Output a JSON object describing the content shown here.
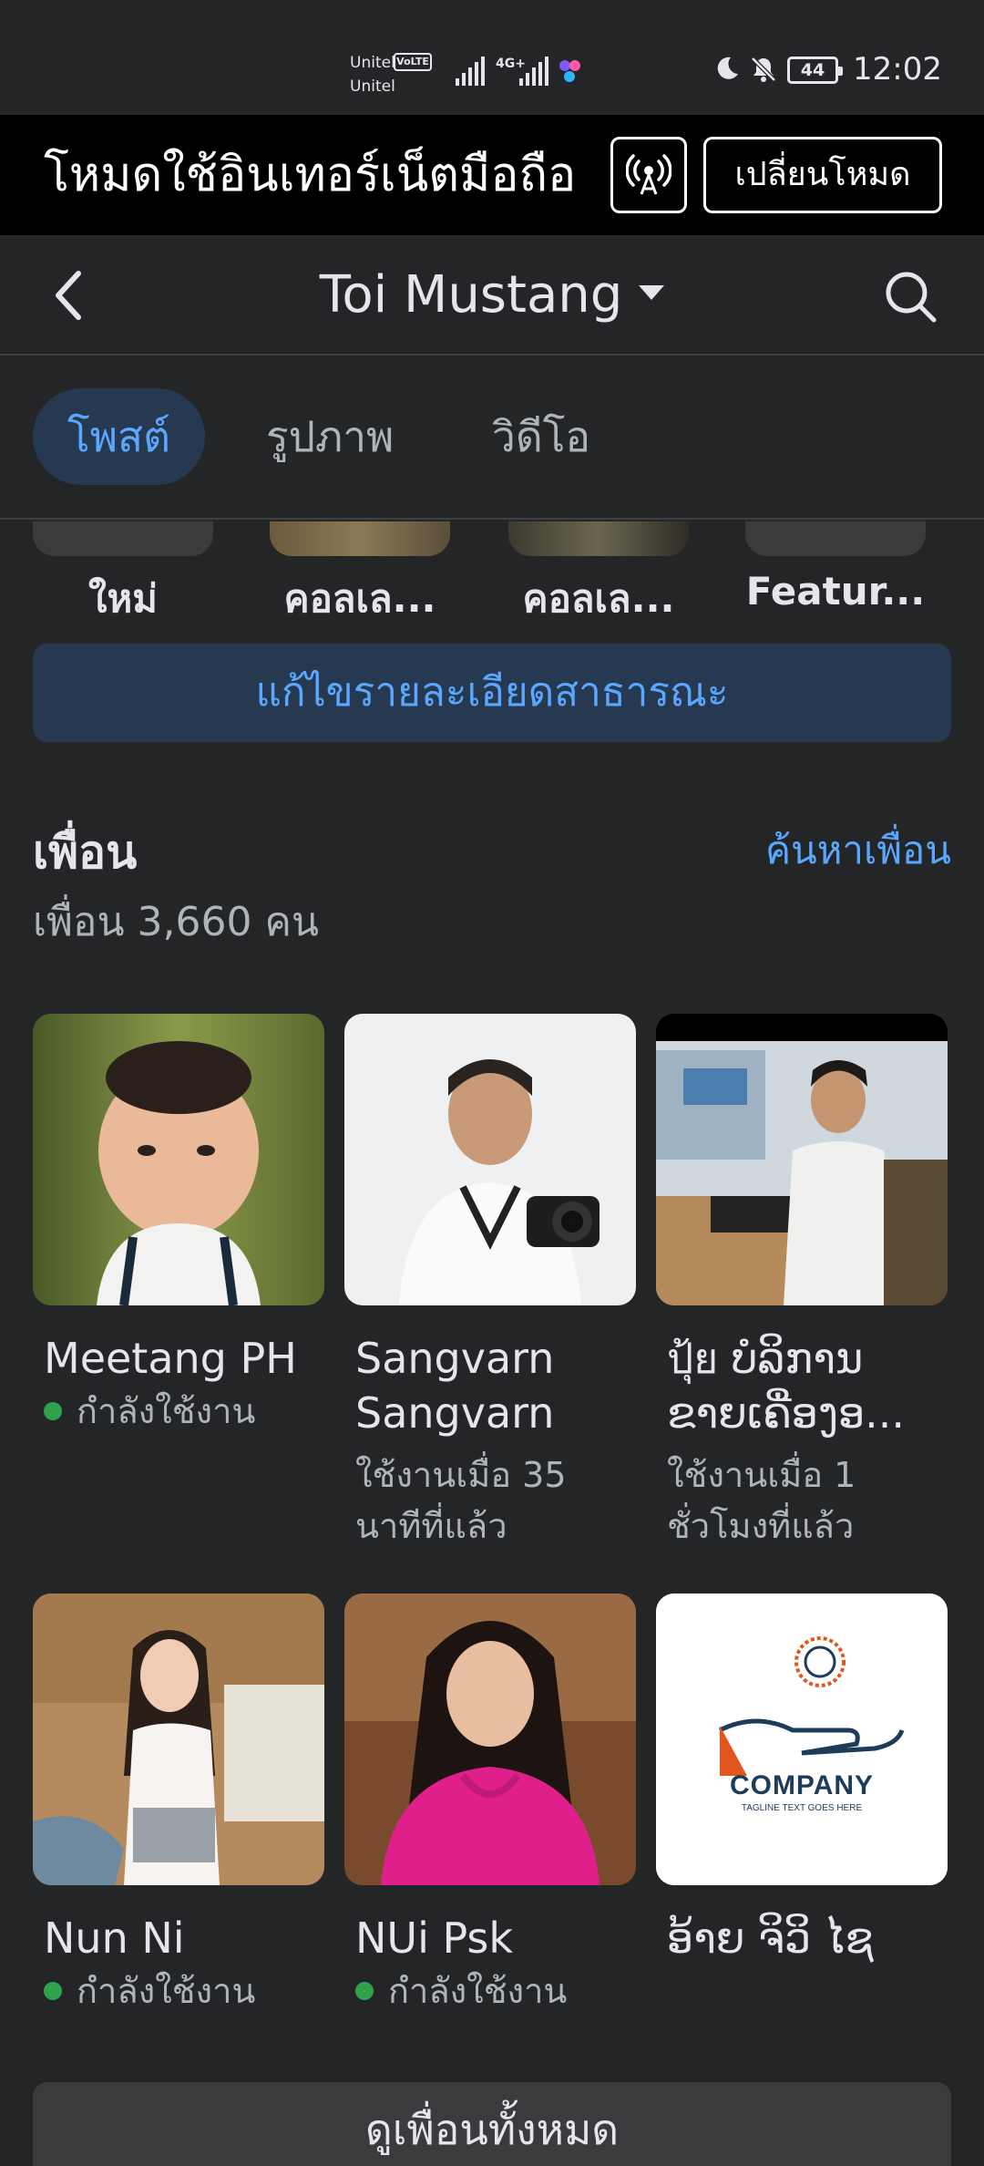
{
  "status_bar": {
    "carrier1": "Unitel",
    "carrier2": "Unitel",
    "volte": "VoLTE",
    "network": "4G+",
    "battery": "44",
    "time": "12:02"
  },
  "banner": {
    "text": "โหมดใช้อินเทอร์เน็ตมือถือ",
    "switch_label": "เปลี่ยนโหมด"
  },
  "topnav": {
    "title": "Toi Mustang"
  },
  "tabs": [
    {
      "label": "โพสต์",
      "active": true
    },
    {
      "label": "รูปภาพ",
      "active": false
    },
    {
      "label": "วิดีโอ",
      "active": false
    }
  ],
  "featured": [
    {
      "label": "ใหม่"
    },
    {
      "label": "คอลเล..."
    },
    {
      "label": "คอลเล..."
    },
    {
      "label": "Featur..."
    }
  ],
  "edit_public": "แก้ไขรายละเอียดสาธารณะ",
  "friends": {
    "title": "เพื่อน",
    "find_link": "ค้นหาเพื่อน",
    "count": "เพื่อน 3,660 คน",
    "list": [
      {
        "name": "Meetang PH",
        "status": "กำลังใช้งาน",
        "online": true
      },
      {
        "name": "Sangvarn Sangvarn",
        "status": "ใช้งานเมื่อ 35 นาทีที่แล้ว",
        "online": false
      },
      {
        "name": "ปุ้ย ບໍລິການ ຂາຍເຄື່ອງອ...",
        "status": "ใช้งานเมื่อ 1 ชั่วโมงที่แล้ว",
        "online": false
      },
      {
        "name": "Nun Ni",
        "status": "กำลังใช้งาน",
        "online": true
      },
      {
        "name": "NUi Psk",
        "status": "กำลังใช้งาน",
        "online": true
      },
      {
        "name": "ອ້າຍ ຈິວິ ໄຊ",
        "status": "",
        "online": false
      }
    ],
    "company_logo": {
      "word": "COMPANY",
      "tagline": "TAGLINE TEXT GOES HERE"
    }
  },
  "see_all": "ดูเพื่อนทั้งหมด",
  "colors": {
    "background": "#242526",
    "accent": "#5aa7ff",
    "accent_bg": "#263951",
    "online": "#31a24c"
  }
}
